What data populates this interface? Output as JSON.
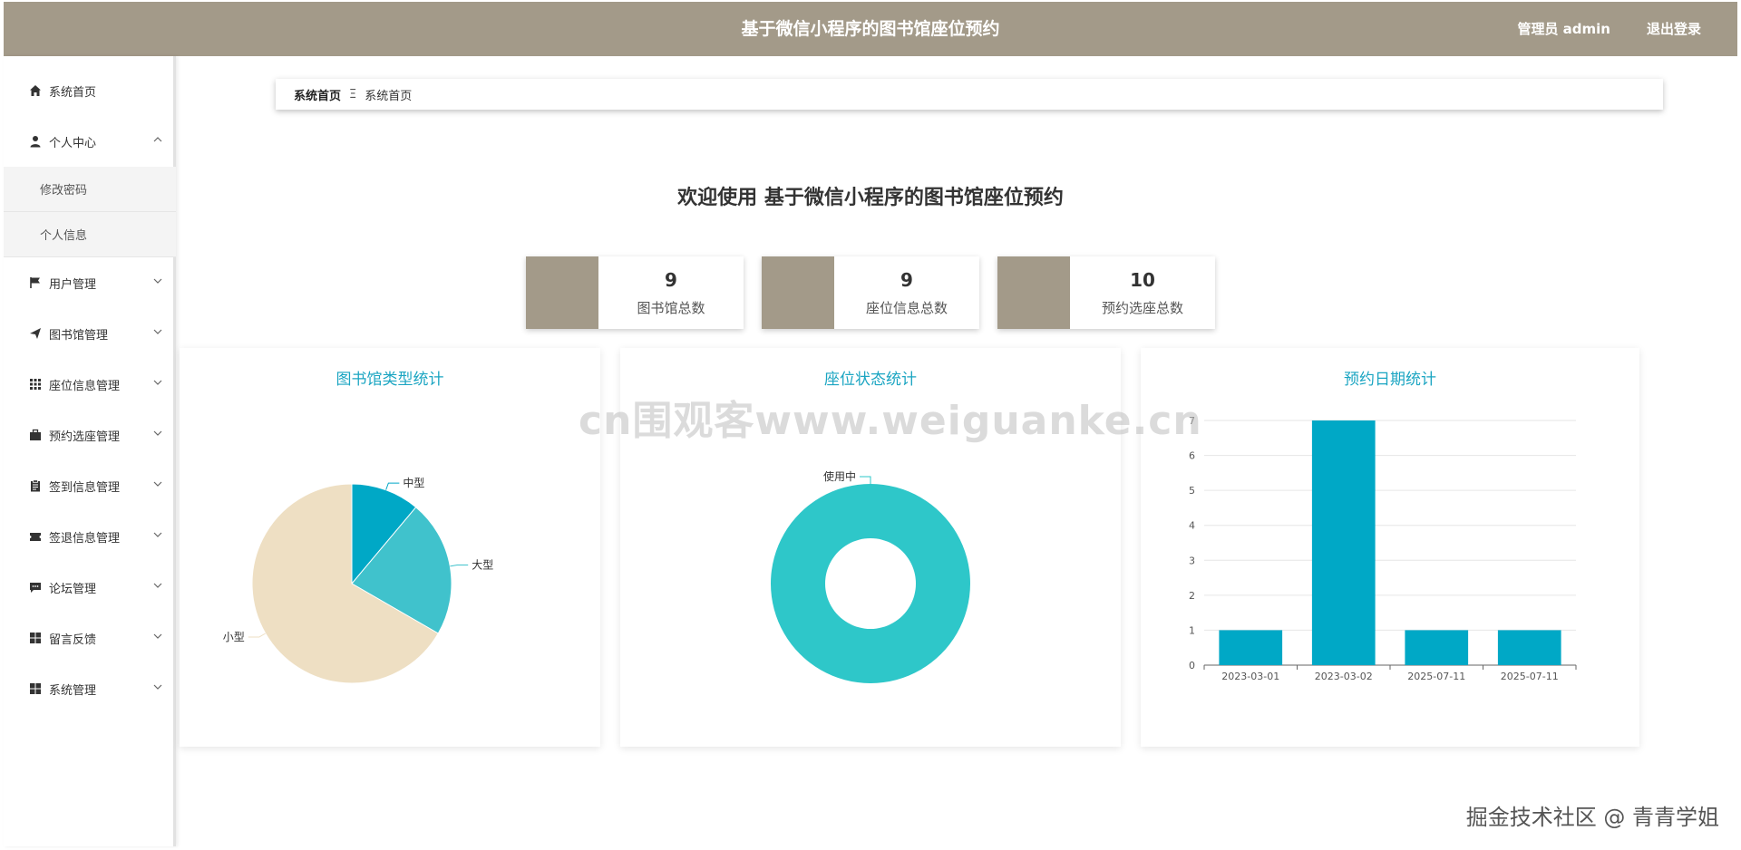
{
  "header": {
    "title": "基于微信小程序的图书馆座位预约",
    "user": "管理员 admin",
    "logout": "退出登录"
  },
  "sidebar": {
    "items": [
      {
        "label": "系统首页",
        "icon": "home-icon"
      },
      {
        "label": "个人中心",
        "icon": "user-icon",
        "expanded": true,
        "children": [
          {
            "label": "修改密码"
          },
          {
            "label": "个人信息"
          }
        ]
      },
      {
        "label": "用户管理",
        "icon": "flag-icon"
      },
      {
        "label": "图书馆管理",
        "icon": "paper-plane-icon"
      },
      {
        "label": "座位信息管理",
        "icon": "grid-icon"
      },
      {
        "label": "预约选座管理",
        "icon": "briefcase-icon"
      },
      {
        "label": "签到信息管理",
        "icon": "clipboard-icon"
      },
      {
        "label": "签退信息管理",
        "icon": "ticket-icon"
      },
      {
        "label": "论坛管理",
        "icon": "comment-icon"
      },
      {
        "label": "留言反馈",
        "icon": "dashboard-icon"
      },
      {
        "label": "系统管理",
        "icon": "dashboard-icon"
      }
    ]
  },
  "breadcrumb": {
    "first": "系统首页",
    "separator": "Ξ",
    "current": "系统首页"
  },
  "welcome": "欢迎使用 基于微信小程序的图书馆座位预约",
  "stats": [
    {
      "value": "9",
      "label": "图书馆总数"
    },
    {
      "value": "9",
      "label": "座位信息总数"
    },
    {
      "value": "10",
      "label": "预约选座总数"
    }
  ],
  "colors": {
    "accent": "#a39a89",
    "chart_title": "#1ba5c2",
    "bar": "#00a8c6",
    "donut": "#2ec7c9"
  },
  "chart_data": [
    {
      "type": "pie",
      "title": "图书馆类型统计",
      "categories": [
        "中型",
        "大型",
        "小型"
      ],
      "values": [
        1,
        2,
        6
      ],
      "colors": [
        "#00a8c6",
        "#40c2cc",
        "#eedfc3"
      ]
    },
    {
      "type": "pie",
      "title": "座位状态统计",
      "categories": [
        "使用中"
      ],
      "values": [
        9
      ],
      "donut": true,
      "colors": [
        "#2ec7c9"
      ]
    },
    {
      "type": "bar",
      "title": "预约日期统计",
      "categories": [
        "2023-03-01",
        "2023-03-02",
        "2025-07-11",
        "2025-07-11"
      ],
      "values": [
        1,
        7,
        1,
        1
      ],
      "ylim": [
        0,
        7
      ],
      "yticks": [
        "0",
        "1",
        "2",
        "3",
        "4",
        "5",
        "6",
        "7"
      ],
      "grid": true
    }
  ],
  "watermarks": {
    "center": "cn围观客www.weiguanke.cn",
    "corner": "掘金技术社区 @ 青青学姐"
  }
}
